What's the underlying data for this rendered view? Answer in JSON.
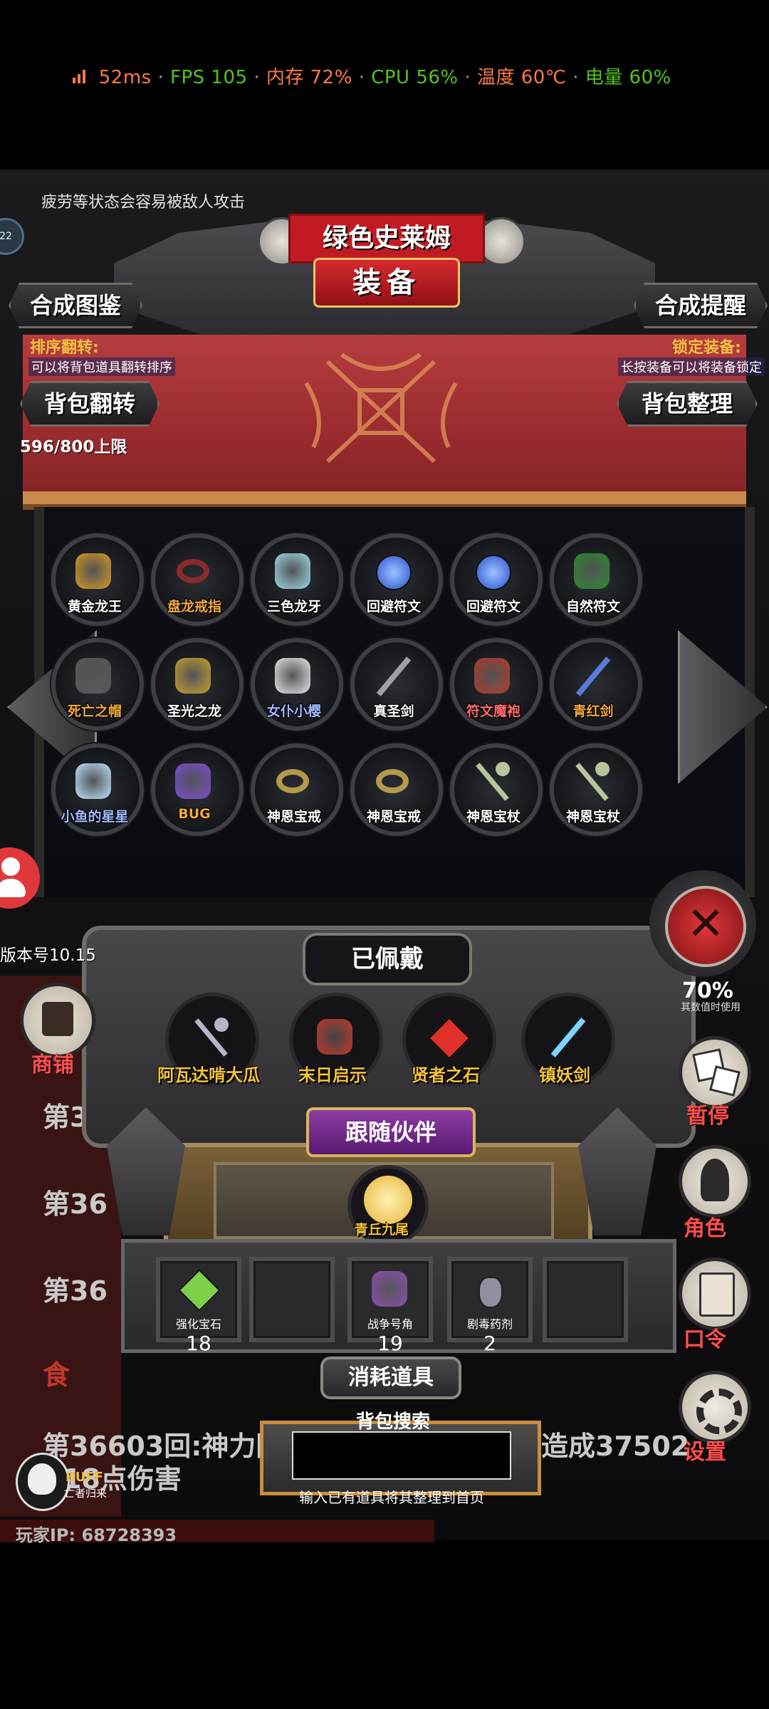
{
  "status": {
    "latency": "52ms",
    "fps": "FPS 105",
    "memory": "内存 72%",
    "cpu": "CPU 56%",
    "temp": "温度 60℃",
    "battery": "电量 60%",
    "sep": "·",
    "colors": {
      "latency": "#ff7a45",
      "fps": "#52c41a",
      "memory": "#ff7a45",
      "cpu": "#52c41a",
      "temp": "#ff7a45",
      "battery": "#52c41a"
    }
  },
  "game": {
    "tip": "疲劳等状态会容易被敌人攻击",
    "level_badge": "22",
    "monster_name": "绿色史莱姆",
    "title": "装备",
    "buttons": {
      "collection": "合成图鉴",
      "reminder": "合成提醒",
      "flip": "背包翻转",
      "sort": "背包整理"
    },
    "flip_label": "排序翻转:",
    "flip_desc": "可以将背包道具翻转排序",
    "lock_label": "锁定装备:",
    "lock_desc": "长按装备可以将装备锁定",
    "bag_limit": "596/800上限",
    "items": [
      {
        "name": "黄金龙王",
        "color": "#ffffff",
        "icon": "dragon-icon",
        "tint": "#d79a22"
      },
      {
        "name": "盘龙戒指",
        "color": "#f2a93b",
        "icon": "ring-icon",
        "tint": "#8a2a2a"
      },
      {
        "name": "三色龙牙",
        "color": "#ffffff",
        "icon": "fang-icon",
        "tint": "#9fd9e6"
      },
      {
        "name": "回避符文",
        "color": "#ffffff",
        "icon": "rune-icon",
        "tint": "#2a4fd0"
      },
      {
        "name": "回避符文",
        "color": "#ffffff",
        "icon": "rune-icon",
        "tint": "#2a4fd0"
      },
      {
        "name": "自然符文",
        "color": "#ffffff",
        "icon": "leaf-rune-icon",
        "tint": "#2e8a2e"
      },
      {
        "name": "死亡之帽",
        "color": "#f2a93b",
        "icon": "hat-icon",
        "tint": "#5a5a5a"
      },
      {
        "name": "圣光之龙",
        "color": "#ffffff",
        "icon": "dragon-icon",
        "tint": "#c7a030"
      },
      {
        "name": "女仆小樱",
        "color": "#9fb7ff",
        "icon": "maid-icon",
        "tint": "#e8e8e8"
      },
      {
        "name": "真圣剑",
        "color": "#ffffff",
        "icon": "sword-icon",
        "tint": "#a0a0a0"
      },
      {
        "name": "符文魔袍",
        "color": "#ff6b6b",
        "icon": "robe-icon",
        "tint": "#b13d2b"
      },
      {
        "name": "青红剑",
        "color": "#f2a93b",
        "icon": "sword-icon",
        "tint": "#5b7bd6"
      },
      {
        "name": "小鱼的星星",
        "color": "#9fb7ff",
        "icon": "star-wand-icon",
        "tint": "#bfe6ff"
      },
      {
        "name": "BUG",
        "color": "#f2a93b",
        "icon": "bug-icon",
        "tint": "#7b4fd0"
      },
      {
        "name": "神恩宝戒",
        "color": "#ffffff",
        "icon": "ring-icon",
        "tint": "#b39a4a"
      },
      {
        "name": "神恩宝戒",
        "color": "#ffffff",
        "icon": "ring-icon",
        "tint": "#b39a4a"
      },
      {
        "name": "神恩宝杖",
        "color": "#ffffff",
        "icon": "staff-icon",
        "tint": "#b8c49a"
      },
      {
        "name": "神恩宝杖",
        "color": "#ffffff",
        "icon": "staff-icon",
        "tint": "#b8c49a"
      }
    ],
    "equipped_title": "已佩戴",
    "equipped": [
      {
        "name": "阿瓦达啃大瓜",
        "icon": "staff-icon",
        "tint": "#b9b2c8"
      },
      {
        "name": "末日启示",
        "icon": "axe-icon",
        "tint": "#c0392b"
      },
      {
        "name": "贤者之石",
        "icon": "gem-icon",
        "tint": "#e0302a"
      },
      {
        "name": "镇妖剑",
        "icon": "sword-icon",
        "tint": "#7fd3ff"
      }
    ],
    "companion_title": "跟随伙伴",
    "companion": {
      "name": "青丘九尾",
      "icon": "fox-icon",
      "tint": "#e6b53a"
    },
    "consumables_title": "消耗道具",
    "consumables": [
      {
        "name": "强化宝石",
        "count": "18",
        "icon": "gem-icon",
        "tint": "#7ed04a"
      },
      {
        "name": "",
        "count": "",
        "icon": "",
        "tint": ""
      },
      {
        "name": "战争号角",
        "count": "19",
        "icon": "horn-icon",
        "tint": "#8a4fb0"
      },
      {
        "name": "剧毒药剂",
        "count": "2",
        "icon": "potion-icon",
        "tint": "#8f8fa0"
      },
      {
        "name": "",
        "count": "",
        "icon": "",
        "tint": ""
      }
    ],
    "search": {
      "title": "背包搜索",
      "value": "",
      "placeholder": "",
      "tip": "输入已有道具将其整理到首页"
    },
    "version": "版本号10.15",
    "shop": "商铺",
    "log_lines": {
      "l1": "第3",
      "l2": "第36",
      "l3": "第36",
      "l4": "食",
      "l5a": "第36603回:神力附",
      "l5b": "造成37502",
      "l6": "18点伤害"
    },
    "buff_label": "BUFF",
    "buff_sub": "亡者归来",
    "player_ip": "玩家IP: 68728393",
    "right_partial": "70%",
    "right_partial_sub": "其数值时使用",
    "side": {
      "pause": "暂停",
      "role": "角色",
      "code": "口令",
      "settings": "设置"
    }
  }
}
